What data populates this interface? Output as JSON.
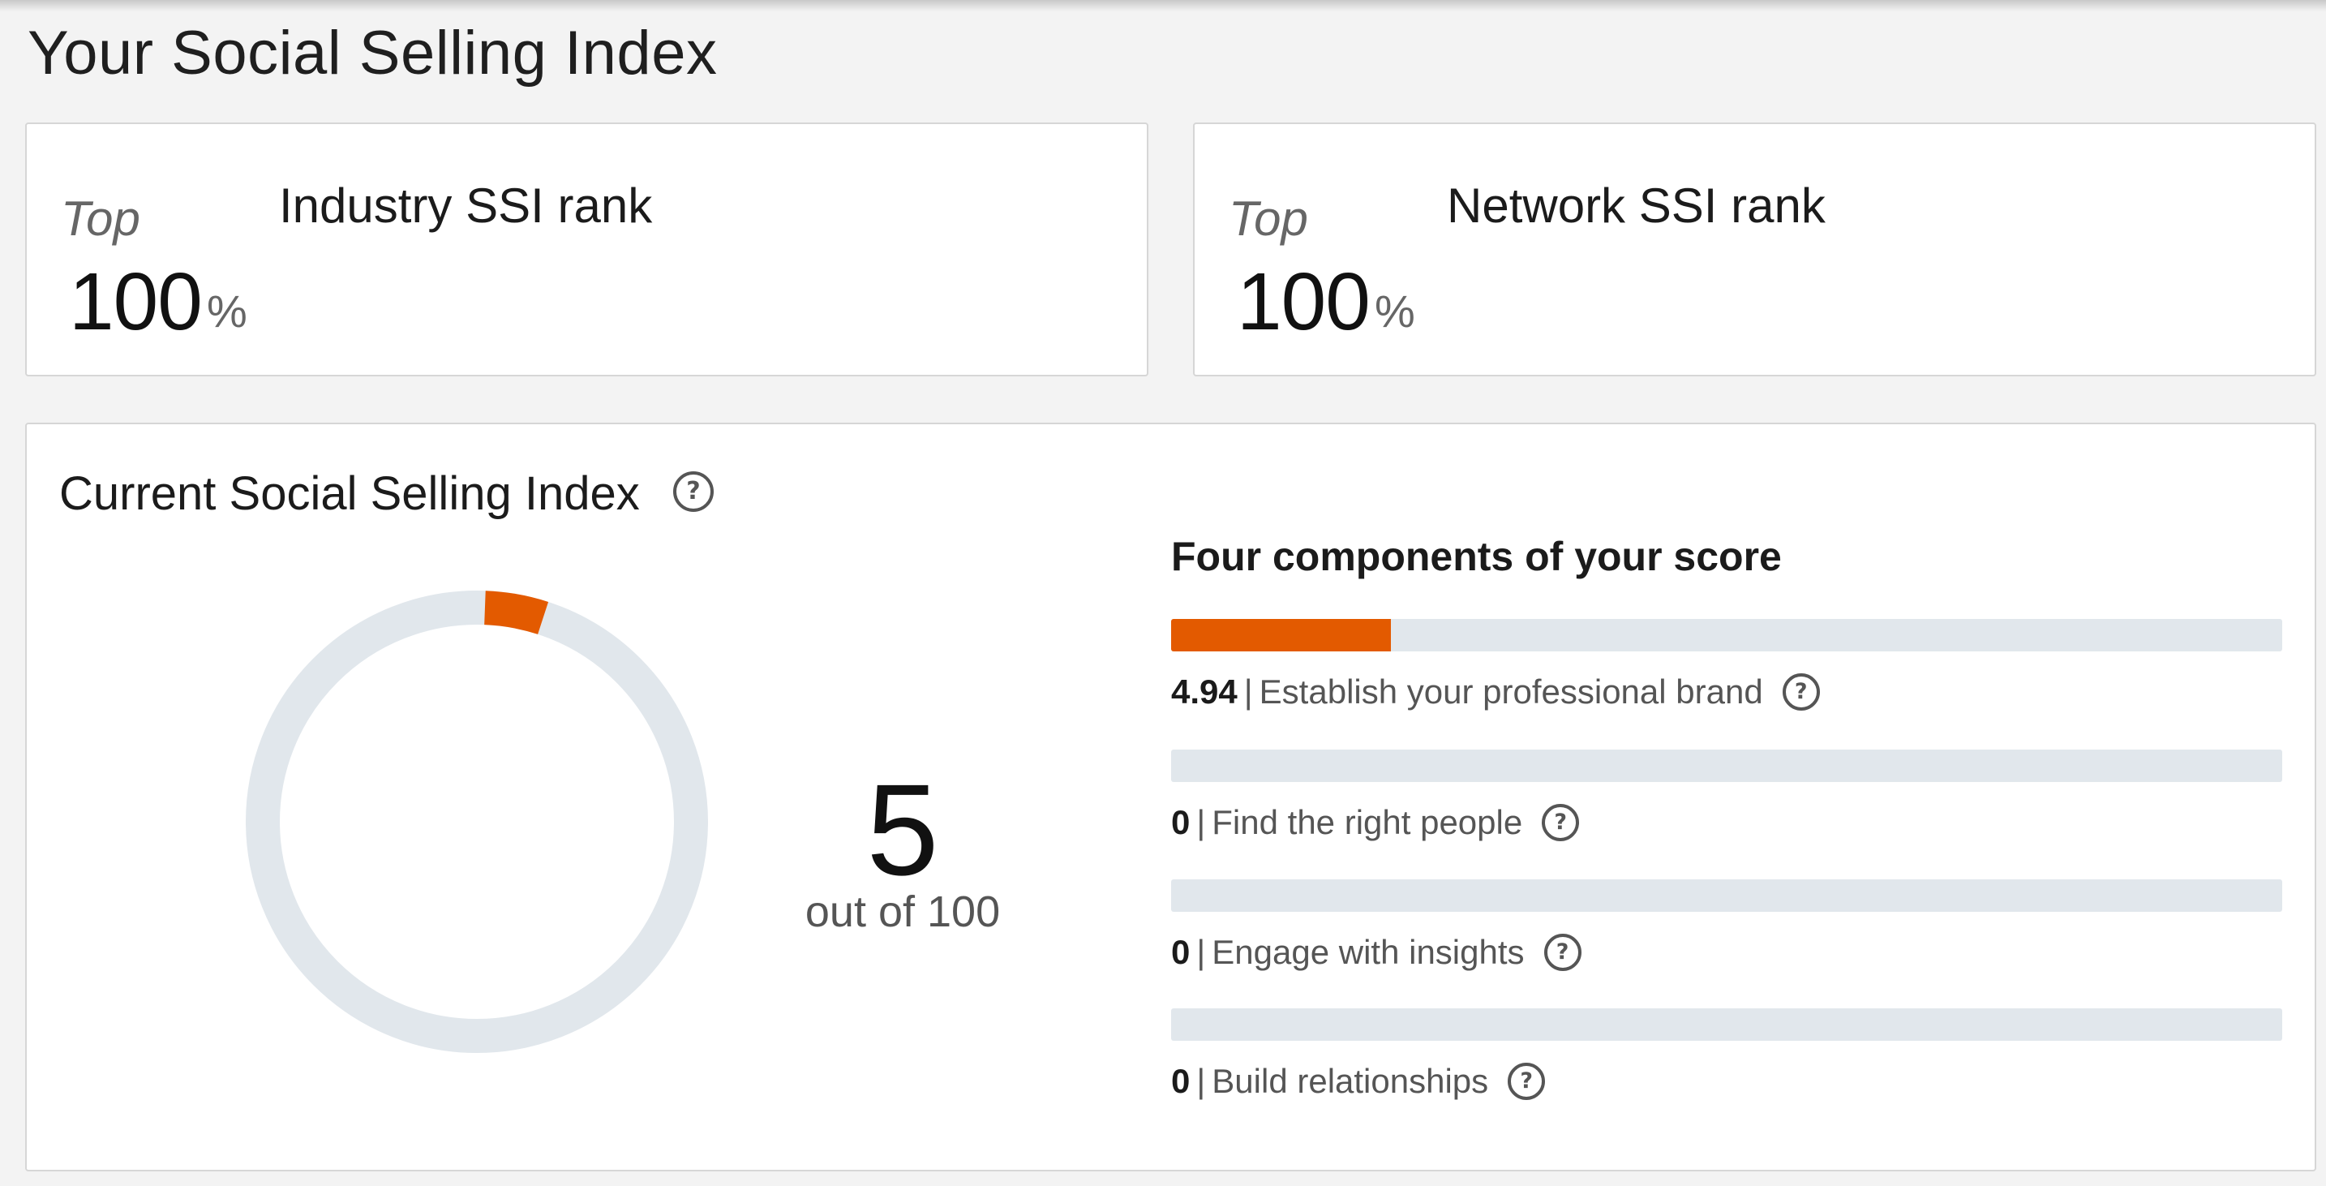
{
  "page": {
    "title": "Your Social Selling Index"
  },
  "ranks": [
    {
      "prefix": "Top",
      "value": "100",
      "unit": "%",
      "label": "Industry SSI rank"
    },
    {
      "prefix": "Top",
      "value": "100",
      "unit": "%",
      "label": "Network SSI rank"
    }
  ],
  "current": {
    "title": "Current Social Selling Index",
    "help_icon": "question-circle-icon",
    "score": "5",
    "out_of": "out of 100",
    "score_fraction": 0.05,
    "accent_color": "#e35a00",
    "track_color": "#e1e7ec"
  },
  "components": {
    "title": "Four components of your score",
    "max_per_component": 25,
    "items": [
      {
        "value": "4.94",
        "label": "Establish your professional brand",
        "fraction": 0.1976
      },
      {
        "value": "0",
        "label": "Find the right people",
        "fraction": 0
      },
      {
        "value": "0",
        "label": "Engage with insights",
        "fraction": 0
      },
      {
        "value": "0",
        "label": "Build relationships",
        "fraction": 0
      }
    ]
  }
}
